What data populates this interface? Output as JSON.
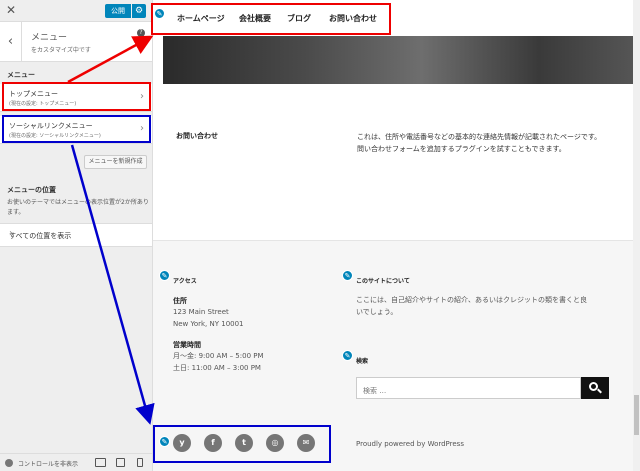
{
  "sidebar": {
    "close_icon": "close-icon",
    "publish_label": "公開",
    "settings_icon": "gear-icon",
    "back_icon": "chevron-left-icon",
    "panel_title": "メニュー",
    "panel_subtitle": "をカスタマイズ中です",
    "help_icon": "help-icon",
    "section_label": "メニュー",
    "menus": [
      {
        "title": "トップメニュー",
        "subtitle": "(現在の設定: トップメニュー)"
      },
      {
        "title": "ソーシャルリンクメニュー",
        "subtitle": "(現在の設定: ソーシャルリンクメニュー)"
      }
    ],
    "add_menu_label": "メニューを新規作成",
    "locations_title": "メニューの位置",
    "locations_desc": "お使いのテーマではメニューの表示位置が2か所あります。",
    "view_all_label": "すべての位置を表示",
    "hide_controls_label": "コントロールを非表示"
  },
  "preview": {
    "nav": [
      "ホームページ",
      "会社概要",
      "ブログ",
      "お問い合わせ"
    ],
    "contact_label": "お問い合わせ",
    "contact_text": "これは、住所や電話番号などの基本的な連絡先情報が記載されたページです。問い合わせフォームを追加するプラグインを試すこともできます。",
    "access": {
      "title": "アクセス",
      "address_label": "住所",
      "address_line1": "123 Main Street",
      "address_line2": "New York, NY 10001",
      "hours_label": "営業時間",
      "hours_line1": "月〜金: 9:00 AM – 5:00 PM",
      "hours_line2": "土日: 11:00 AM – 3:00 PM"
    },
    "about": {
      "title": "このサイトについて",
      "text": "ここには、自己紹介やサイトの紹介、あるいはクレジットの類を書くと良いでしょう。"
    },
    "search": {
      "title": "検索",
      "placeholder": "検索 …"
    },
    "social_icons": [
      "yelp-icon",
      "facebook-icon",
      "twitter-icon",
      "instagram-icon",
      "email-icon"
    ],
    "powered_by": "Proudly powered by WordPress"
  },
  "colors": {
    "accent": "#0085ba",
    "annotation_red": "#ee0000",
    "annotation_blue": "#0000cc"
  }
}
